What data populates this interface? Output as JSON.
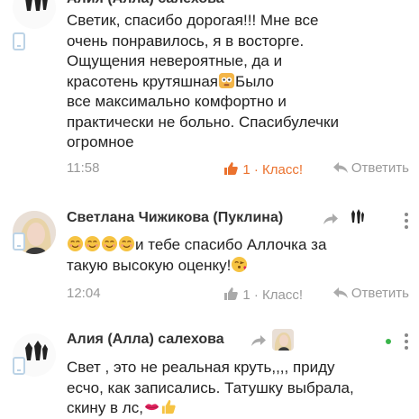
{
  "comments": [
    {
      "author": "Алия (Алла) салехова",
      "text_lines": [
        "Светик, спасибо дорогая!!! Мне все",
        "очень понравилось, я в восторге.",
        "Ощущения невероятные, да и",
        "красотень крутяшная",
        "все максимально комфортно и",
        "практически не больно. Спасибулечки",
        "огромное"
      ],
      "text_line4_tail": "Было",
      "time": "11:58",
      "likes": "1 · Класс!",
      "reply_label": "Ответить"
    },
    {
      "author": "Светлана Чижикова (Пуклина)",
      "text_line1": "и тебе спасибо Аллочка за",
      "text_line2": "такую высокую оценку!",
      "time": "12:04",
      "likes": "1 · Класс!",
      "reply_label": "Ответить"
    },
    {
      "author": "Алия (Алла) салехова",
      "text_lines": [
        "Свет , это не реальная круть,,,, приду",
        "есчо, как записались. Татушку выбрала,",
        "скину в лс,"
      ]
    }
  ],
  "colors": {
    "accent": "#eb722e",
    "muted": "#999999",
    "online": "#3ab54a"
  }
}
